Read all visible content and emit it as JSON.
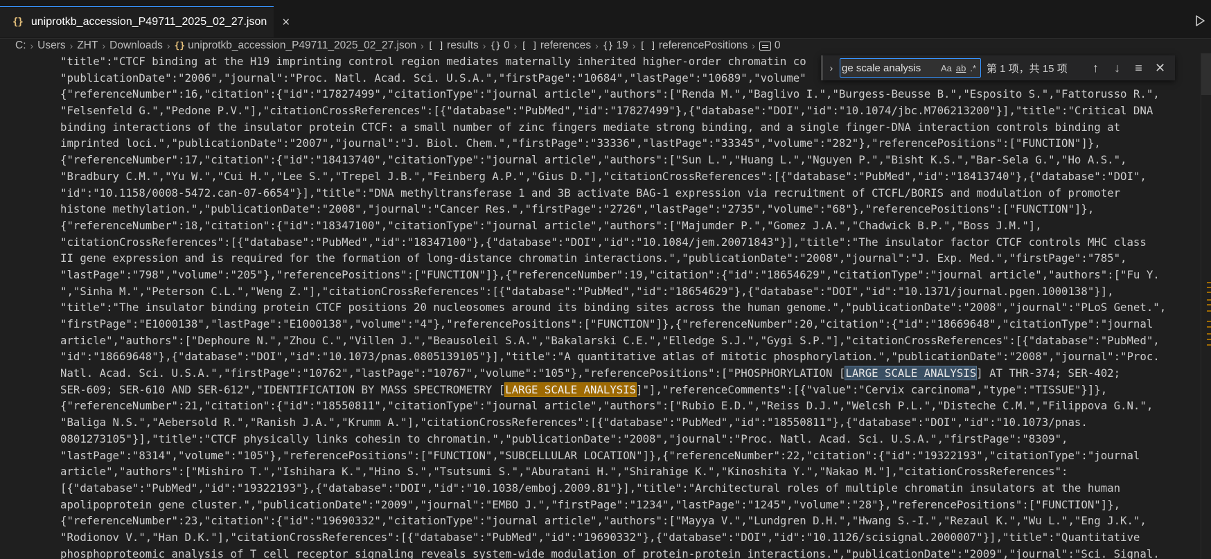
{
  "tab": {
    "icon": "{}",
    "title": "uniprotkb_accession_P49711_2025_02_27.json",
    "close": "×"
  },
  "breadcrumb": [
    {
      "kind": "text",
      "label": "C:"
    },
    {
      "kind": "text",
      "label": "Users"
    },
    {
      "kind": "text",
      "label": "ZHT"
    },
    {
      "kind": "text",
      "label": "Downloads"
    },
    {
      "kind": "file",
      "symbol": "{}",
      "label": "uniprotkb_accession_P49711_2025_02_27.json"
    },
    {
      "kind": "array",
      "symbol": "[ ]",
      "label": "results"
    },
    {
      "kind": "object",
      "symbol": "{}",
      "label": "0"
    },
    {
      "kind": "array",
      "symbol": "[ ]",
      "label": "references"
    },
    {
      "kind": "object",
      "symbol": "{}",
      "label": "19"
    },
    {
      "kind": "array",
      "symbol": "[ ]",
      "label": "referencePositions"
    },
    {
      "kind": "box",
      "symbol": "",
      "label": "0"
    }
  ],
  "find": {
    "toggle": "›",
    "query": "ge scale analysis",
    "opt_case": "Aa",
    "opt_word": "ab",
    "opt_regex": ".*",
    "count": "第 1 项，共 15 项",
    "prev": "↑",
    "next": "↓",
    "selection": "≡",
    "close": "✕"
  },
  "code_lines": [
    [
      {
        "t": "\"title\":\"CTCF binding at the H19 imprinting control region mediates maternally inherited higher-order chromatin co"
      }
    ],
    [
      {
        "t": "\"publicationDate\":\"2006\",\"journal\":\"Proc. Natl. Acad. Sci. U.S.A.\",\"firstPage\":\"10684\",\"lastPage\":\"10689\",\"volume\""
      }
    ],
    [
      {
        "t": "{\"referenceNumber\":16,\"citation\":{\"id\":\"17827499\",\"citationType\":\"journal article\",\"authors\":[\"Renda M.\",\"Baglivo I.\",\"Burgess-Beusse B.\",\"Esposito S.\",\"Fattorusso R.\","
      }
    ],
    [
      {
        "t": "\"Felsenfeld G.\",\"Pedone P.V.\"],\"citationCrossReferences\":[{\"database\":\"PubMed\",\"id\":\"17827499\"},{\"database\":\"DOI\",\"id\":\"10.1074/jbc.M706213200\"}],\"title\":\"Critical DNA"
      }
    ],
    [
      {
        "t": "binding interactions of the insulator protein CTCF: a small number of zinc fingers mediate strong binding, and a single finger-DNA interaction controls binding at"
      }
    ],
    [
      {
        "t": "imprinted loci.\",\"publicationDate\":\"2007\",\"journal\":\"J. Biol. Chem.\",\"firstPage\":\"33336\",\"lastPage\":\"33345\",\"volume\":\"282\"},\"referencePositions\":[\"FUNCTION\"]},"
      }
    ],
    [
      {
        "t": "{\"referenceNumber\":17,\"citation\":{\"id\":\"18413740\",\"citationType\":\"journal article\",\"authors\":[\"Sun L.\",\"Huang L.\",\"Nguyen P.\",\"Bisht K.S.\",\"Bar-Sela G.\",\"Ho A.S.\","
      }
    ],
    [
      {
        "t": "\"Bradbury C.M.\",\"Yu W.\",\"Cui H.\",\"Lee S.\",\"Trepel J.B.\",\"Feinberg A.P.\",\"Gius D.\"],\"citationCrossReferences\":[{\"database\":\"PubMed\",\"id\":\"18413740\"},{\"database\":\"DOI\","
      }
    ],
    [
      {
        "t": "\"id\":\"10.1158/0008-5472.can-07-6654\"}],\"title\":\"DNA methyltransferase 1 and 3B activate BAG-1 expression via recruitment of CTCFL/BORIS and modulation of promoter"
      }
    ],
    [
      {
        "t": "histone methylation.\",\"publicationDate\":\"2008\",\"journal\":\"Cancer Res.\",\"firstPage\":\"2726\",\"lastPage\":\"2735\",\"volume\":\"68\"},\"referencePositions\":[\"FUNCTION\"]},"
      }
    ],
    [
      {
        "t": "{\"referenceNumber\":18,\"citation\":{\"id\":\"18347100\",\"citationType\":\"journal article\",\"authors\":[\"Majumder P.\",\"Gomez J.A.\",\"Chadwick B.P.\",\"Boss J.M.\"],"
      }
    ],
    [
      {
        "t": "\"citationCrossReferences\":[{\"database\":\"PubMed\",\"id\":\"18347100\"},{\"database\":\"DOI\",\"id\":\"10.1084/jem.20071843\"}],\"title\":\"The insulator factor CTCF controls MHC class"
      }
    ],
    [
      {
        "t": "II gene expression and is required for the formation of long-distance chromatin interactions.\",\"publicationDate\":\"2008\",\"journal\":\"J. Exp. Med.\",\"firstPage\":\"785\","
      }
    ],
    [
      {
        "t": "\"lastPage\":\"798\",\"volume\":\"205\"},\"referencePositions\":[\"FUNCTION\"]},{\"referenceNumber\":19,\"citation\":{\"id\":\"18654629\",\"citationType\":\"journal article\",\"authors\":[\"Fu Y."
      }
    ],
    [
      {
        "t": "\",\"Sinha M.\",\"Peterson C.L.\",\"Weng Z.\"],\"citationCrossReferences\":[{\"database\":\"PubMed\",\"id\":\"18654629\"},{\"database\":\"DOI\",\"id\":\"10.1371/journal.pgen.1000138\"}],"
      }
    ],
    [
      {
        "t": "\"title\":\"The insulator binding protein CTCF positions 20 nucleosomes around its binding sites across the human genome.\",\"publicationDate\":\"2008\",\"journal\":\"PLoS Genet.\","
      }
    ],
    [
      {
        "t": "\"firstPage\":\"E1000138\",\"lastPage\":\"E1000138\",\"volume\":\"4\"},\"referencePositions\":[\"FUNCTION\"]},{\"referenceNumber\":20,\"citation\":{\"id\":\"18669648\",\"citationType\":\"journal"
      }
    ],
    [
      {
        "t": "article\",\"authors\":[\"Dephoure N.\",\"Zhou C.\",\"Villen J.\",\"Beausoleil S.A.\",\"Bakalarski C.E.\",\"Elledge S.J.\",\"Gygi S.P.\"],\"citationCrossReferences\":[{\"database\":\"PubMed\","
      }
    ],
    [
      {
        "t": "\"id\":\"18669648\"},{\"database\":\"DOI\",\"id\":\"10.1073/pnas.0805139105\"}],\"title\":\"A quantitative atlas of mitotic phosphorylation.\",\"publicationDate\":\"2008\",\"journal\":\"Proc."
      }
    ],
    [
      {
        "t": "Natl. Acad. Sci. U.S.A.\",\"firstPage\":\"10762\",\"lastPage\":\"10767\",\"volume\":\"105\"},\"referencePositions\":[\"PHOSPHORYLATION ["
      },
      {
        "t": "LARGE SCALE ANALYSIS",
        "h": "match"
      },
      {
        "t": "] AT THR-374; SER-402;"
      }
    ],
    [
      {
        "t": "SER-609; SER-610 AND SER-612\",\"IDENTIFICATION BY MASS SPECTROMETRY ["
      },
      {
        "t": "LARGE SCALE ANALYSIS",
        "h": "current"
      },
      {
        "t": "]\"],\"referenceComments\":[{\"value\":\"Cervix carcinoma\",\"type\":\"TISSUE\"}]},"
      }
    ],
    [
      {
        "t": "{\"referenceNumber\":21,\"citation\":{\"id\":\"18550811\",\"citationType\":\"journal article\",\"authors\":[\"Rubio E.D.\",\"Reiss D.J.\",\"Welcsh P.L.\",\"Disteche C.M.\",\"Filippova G.N.\","
      }
    ],
    [
      {
        "t": "\"Baliga N.S.\",\"Aebersold R.\",\"Ranish J.A.\",\"Krumm A.\"],\"citationCrossReferences\":[{\"database\":\"PubMed\",\"id\":\"18550811\"},{\"database\":\"DOI\",\"id\":\"10.1073/pnas."
      }
    ],
    [
      {
        "t": "0801273105\"}],\"title\":\"CTCF physically links cohesin to chromatin.\",\"publicationDate\":\"2008\",\"journal\":\"Proc. Natl. Acad. Sci. U.S.A.\",\"firstPage\":\"8309\","
      }
    ],
    [
      {
        "t": "\"lastPage\":\"8314\",\"volume\":\"105\"},\"referencePositions\":[\"FUNCTION\",\"SUBCELLULAR LOCATION\"]},{\"referenceNumber\":22,\"citation\":{\"id\":\"19322193\",\"citationType\":\"journal"
      }
    ],
    [
      {
        "t": "article\",\"authors\":[\"Mishiro T.\",\"Ishihara K.\",\"Hino S.\",\"Tsutsumi S.\",\"Aburatani H.\",\"Shirahige K.\",\"Kinoshita Y.\",\"Nakao M.\"],\"citationCrossReferences\":"
      }
    ],
    [
      {
        "t": "[{\"database\":\"PubMed\",\"id\":\"19322193\"},{\"database\":\"DOI\",\"id\":\"10.1038/emboj.2009.81\"}],\"title\":\"Architectural roles of multiple chromatin insulators at the human"
      }
    ],
    [
      {
        "t": "apolipoprotein gene cluster.\",\"publicationDate\":\"2009\",\"journal\":\"EMBO J.\",\"firstPage\":\"1234\",\"lastPage\":\"1245\",\"volume\":\"28\"},\"referencePositions\":[\"FUNCTION\"]},"
      }
    ],
    [
      {
        "t": "{\"referenceNumber\":23,\"citation\":{\"id\":\"19690332\",\"citationType\":\"journal article\",\"authors\":[\"Mayya V.\",\"Lundgren D.H.\",\"Hwang S.-I.\",\"Rezaul K.\",\"Wu L.\",\"Eng J.K.\","
      }
    ],
    [
      {
        "t": "\"Rodionov V.\",\"Han D.K.\"],\"citationCrossReferences\":[{\"database\":\"PubMed\",\"id\":\"19690332\"},{\"database\":\"DOI\",\"id\":\"10.1126/scisignal.2000007\"}],\"title\":\"Quantitative"
      }
    ],
    [
      {
        "t": "phosphoproteomic analysis of T cell receptor signaling reveals system-wide modulation of protein-protein interactions.\",\"publicationDate\":\"2009\",\"journal\":\"Sci. Signal."
      }
    ]
  ]
}
